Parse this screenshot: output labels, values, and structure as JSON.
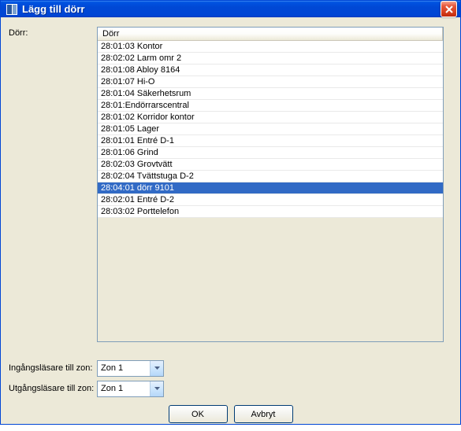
{
  "window": {
    "title": "Lägg till dörr"
  },
  "labels": {
    "door": "Dörr:",
    "column_door": "Dörr",
    "ingang": "Ingångsläsare till zon:",
    "utgang": "Utgångsläsare till zon:"
  },
  "doors": [
    "28:01:03 Kontor",
    "28:02:02 Larm omr 2",
    "28:01:08 Abloy 8164",
    "28:01:07 Hi-O",
    "28:01:04 Säkerhetsrum",
    "28:01:Endörrarscentral",
    "28:01:02 Korridor kontor",
    "28:01:05 Lager",
    "28:01:01 Entré D-1",
    "28:01:06 Grind",
    "28:02:03 Grovtvätt",
    "28:02:04 Tvättstuga D-2",
    "28:04:01 dörr 9101",
    "28:02:01 Entré D-2",
    "28:03:02 Porttelefon"
  ],
  "selected_index": 12,
  "zones": {
    "ingang_value": "Zon 1",
    "utgang_value": "Zon 1"
  },
  "buttons": {
    "ok": "OK",
    "cancel": "Avbryt"
  },
  "colors": {
    "titlebar": "#0046d5",
    "selection": "#316ac5",
    "panel": "#ece9d8",
    "border": "#7f9db9"
  }
}
